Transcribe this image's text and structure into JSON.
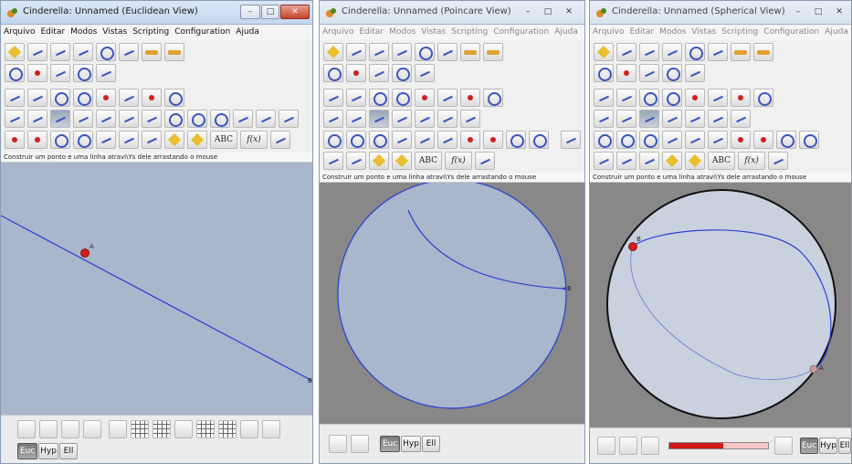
{
  "windows": [
    {
      "title": "Cinderella: Unnamed (Euclidean View)",
      "buttons": {
        "min": "–",
        "max": "□",
        "close": "✕"
      },
      "status_text": "Construir um ponto e uma linha atravi\\Ys dele arrastando o mouse",
      "point_labels": [
        "A",
        "B"
      ],
      "mode_buttons": [
        "Euc",
        "Hyp",
        "Ell"
      ],
      "active_mode": "Euc"
    },
    {
      "title": "Cinderella: Unnamed (Poincare View)",
      "buttons": {
        "min": "–",
        "max": "□",
        "close": "✕"
      },
      "status_text": "Construir um ponto e uma linha atravi\\Ys dele arrastando o mouse",
      "point_labels": [
        "B"
      ],
      "mode_buttons": [
        "Euc",
        "Hyp",
        "Ell"
      ],
      "active_mode": "Euc"
    },
    {
      "title": "Cinderella: Unnamed (Spherical View)",
      "buttons": {
        "min": "–",
        "max": "□",
        "close": "✕"
      },
      "status_text": "Construir um ponto e uma linha atravi\\Ys dele arrastando o mouse",
      "point_labels": [
        "B",
        "A"
      ],
      "mode_buttons": [
        "Euc",
        "Hyp",
        "Ell"
      ],
      "active_mode": "Euc",
      "slider_fraction": 0.55
    }
  ],
  "menu": [
    "Arquivo",
    "Editar",
    "Modos",
    "Vistas",
    "Scripting",
    "Configuration",
    "Ajuda"
  ],
  "tool_labels": {
    "text": "ABC",
    "function": "f(x)"
  },
  "colors": {
    "line": "#2a3fd0",
    "point": "#d81a1a",
    "euclid_bg": "#a9b6cb",
    "gray_bg": "#888888",
    "disk_fill": "#a9b6cb",
    "sphere_fill": "#c9d1df"
  },
  "icons": [
    "app-icon",
    "new-file-icon",
    "open-icon",
    "save-icon",
    "undo-icon",
    "redo-icon",
    "point-tool-icon",
    "line-tool-icon",
    "circle-tool-icon",
    "text-tool-icon",
    "function-tool-icon",
    "mode-icon"
  ]
}
